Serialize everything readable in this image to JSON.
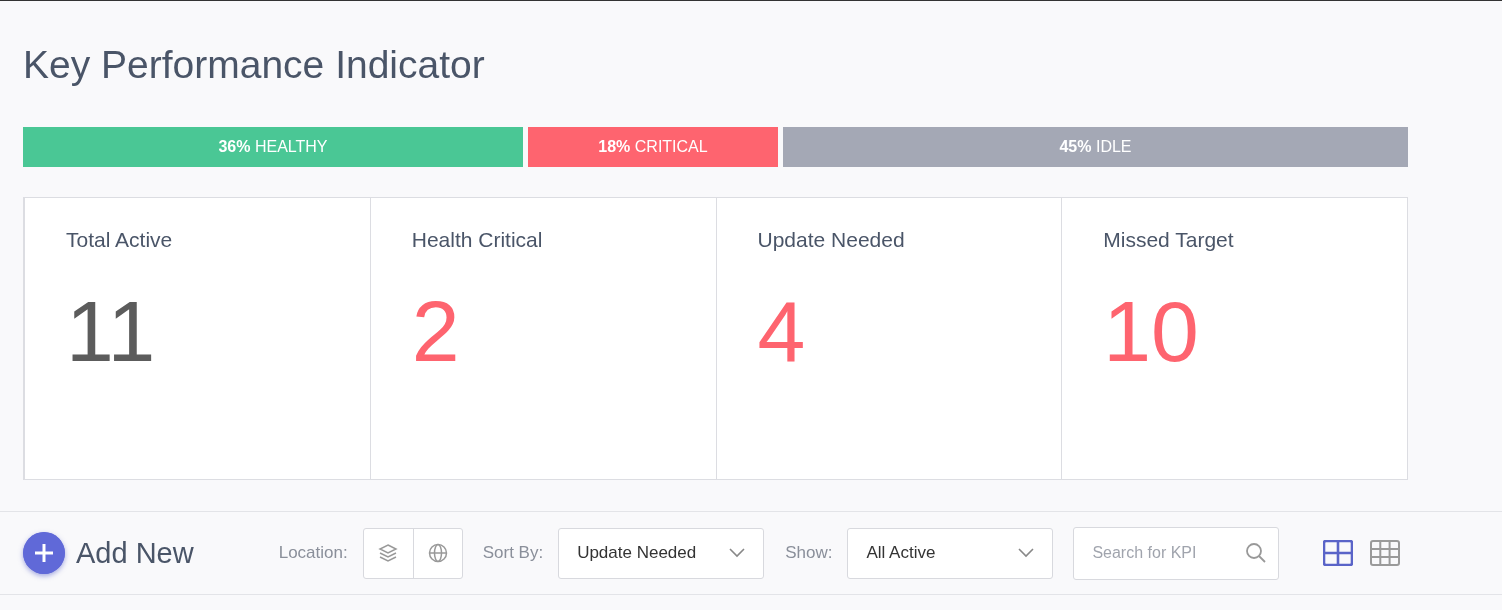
{
  "title": "Key Performance Indicator",
  "status_bar": [
    {
      "label": "**36%** HEALTHY",
      "color": "#4ac795"
    },
    {
      "label": "**18%** CRITICAL",
      "color": "#fe646f"
    },
    {
      "label": "**45%** IDLE",
      "color": "#a4a8b5"
    }
  ],
  "stats": [
    {
      "label": "Total Active",
      "value": "11",
      "color": "#5c5c5c"
    },
    {
      "label": "Health Critical",
      "value": "2",
      "color": "#fe646f"
    },
    {
      "label": "Update Needed",
      "value": "4",
      "color": "#fe646f"
    },
    {
      "label": "Missed Target",
      "value": "10",
      "color": "#fe646f"
    }
  ],
  "toolbar": {
    "add_button": "Add New",
    "location_label": "Location:",
    "sort_label": "Sort By:",
    "sort_value": "Update Needed",
    "show_label": "Show:",
    "show_value": "All Active",
    "search": {
      "placeholder": "Search for KPI"
    },
    "views": [
      {
        "kind": "large-grid",
        "selected": true
      },
      {
        "kind": "small-grid",
        "selected": false
      }
    ]
  }
}
